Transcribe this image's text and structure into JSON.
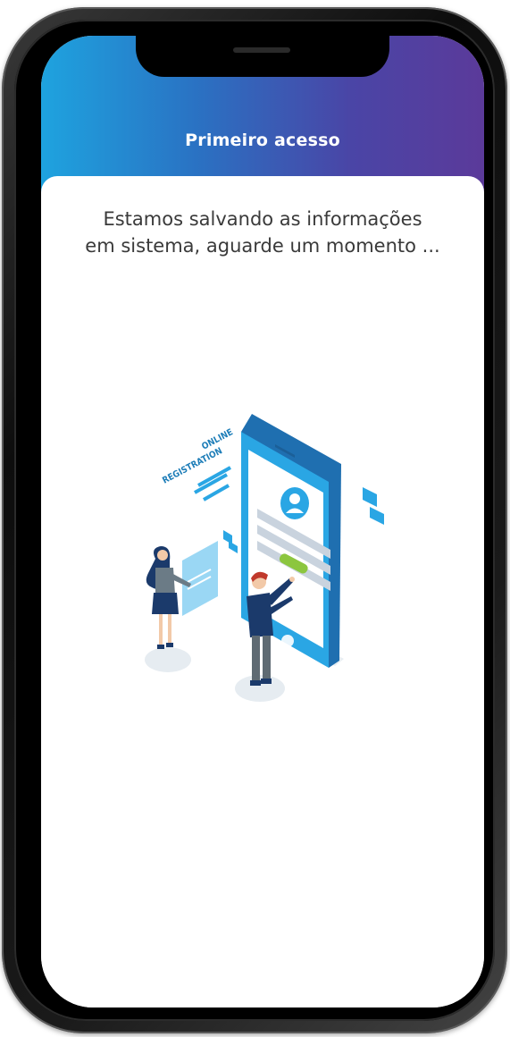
{
  "header": {
    "title": "Primeiro acesso"
  },
  "main": {
    "message_line1": "Estamos salvando as informações",
    "message_line2": "em sistema, aguarde um momento ..."
  },
  "illustration": {
    "text_line1": "ONLINE",
    "text_line2": "REGISTRATION"
  },
  "colors": {
    "header_gradient_start": "#1ea3df",
    "header_gradient_end": "#5b3a9a",
    "phone_blue": "#2aa6e4",
    "accent_green": "#8cc63f"
  }
}
